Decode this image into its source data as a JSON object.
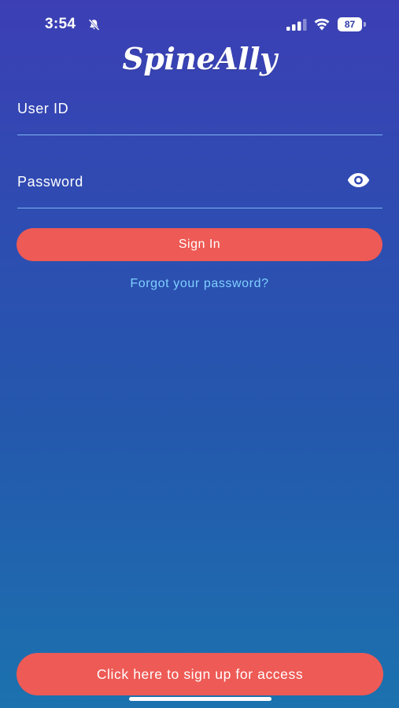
{
  "status_bar": {
    "time": "3:54",
    "battery_level": "87",
    "icons": [
      "bell-slash-icon",
      "cellular-signal-icon",
      "wifi-icon",
      "battery-icon"
    ]
  },
  "app": {
    "logo_text": "SpineAlly"
  },
  "login_form": {
    "user_id_label": "User ID",
    "user_id_value": "",
    "password_label": "Password",
    "password_value": "",
    "show_password_icon": "eye-icon",
    "sign_in_label": "Sign In",
    "forgot_password_label": "Forgot your password?"
  },
  "footer": {
    "signup_label": "Click here to sign up for access"
  },
  "colors": {
    "background_top": "#3c3fb4",
    "background_bottom": "#1b72ae",
    "button": "#ee5a55",
    "link": "#7fd0ff",
    "field_underline": "#7ab6ee"
  }
}
